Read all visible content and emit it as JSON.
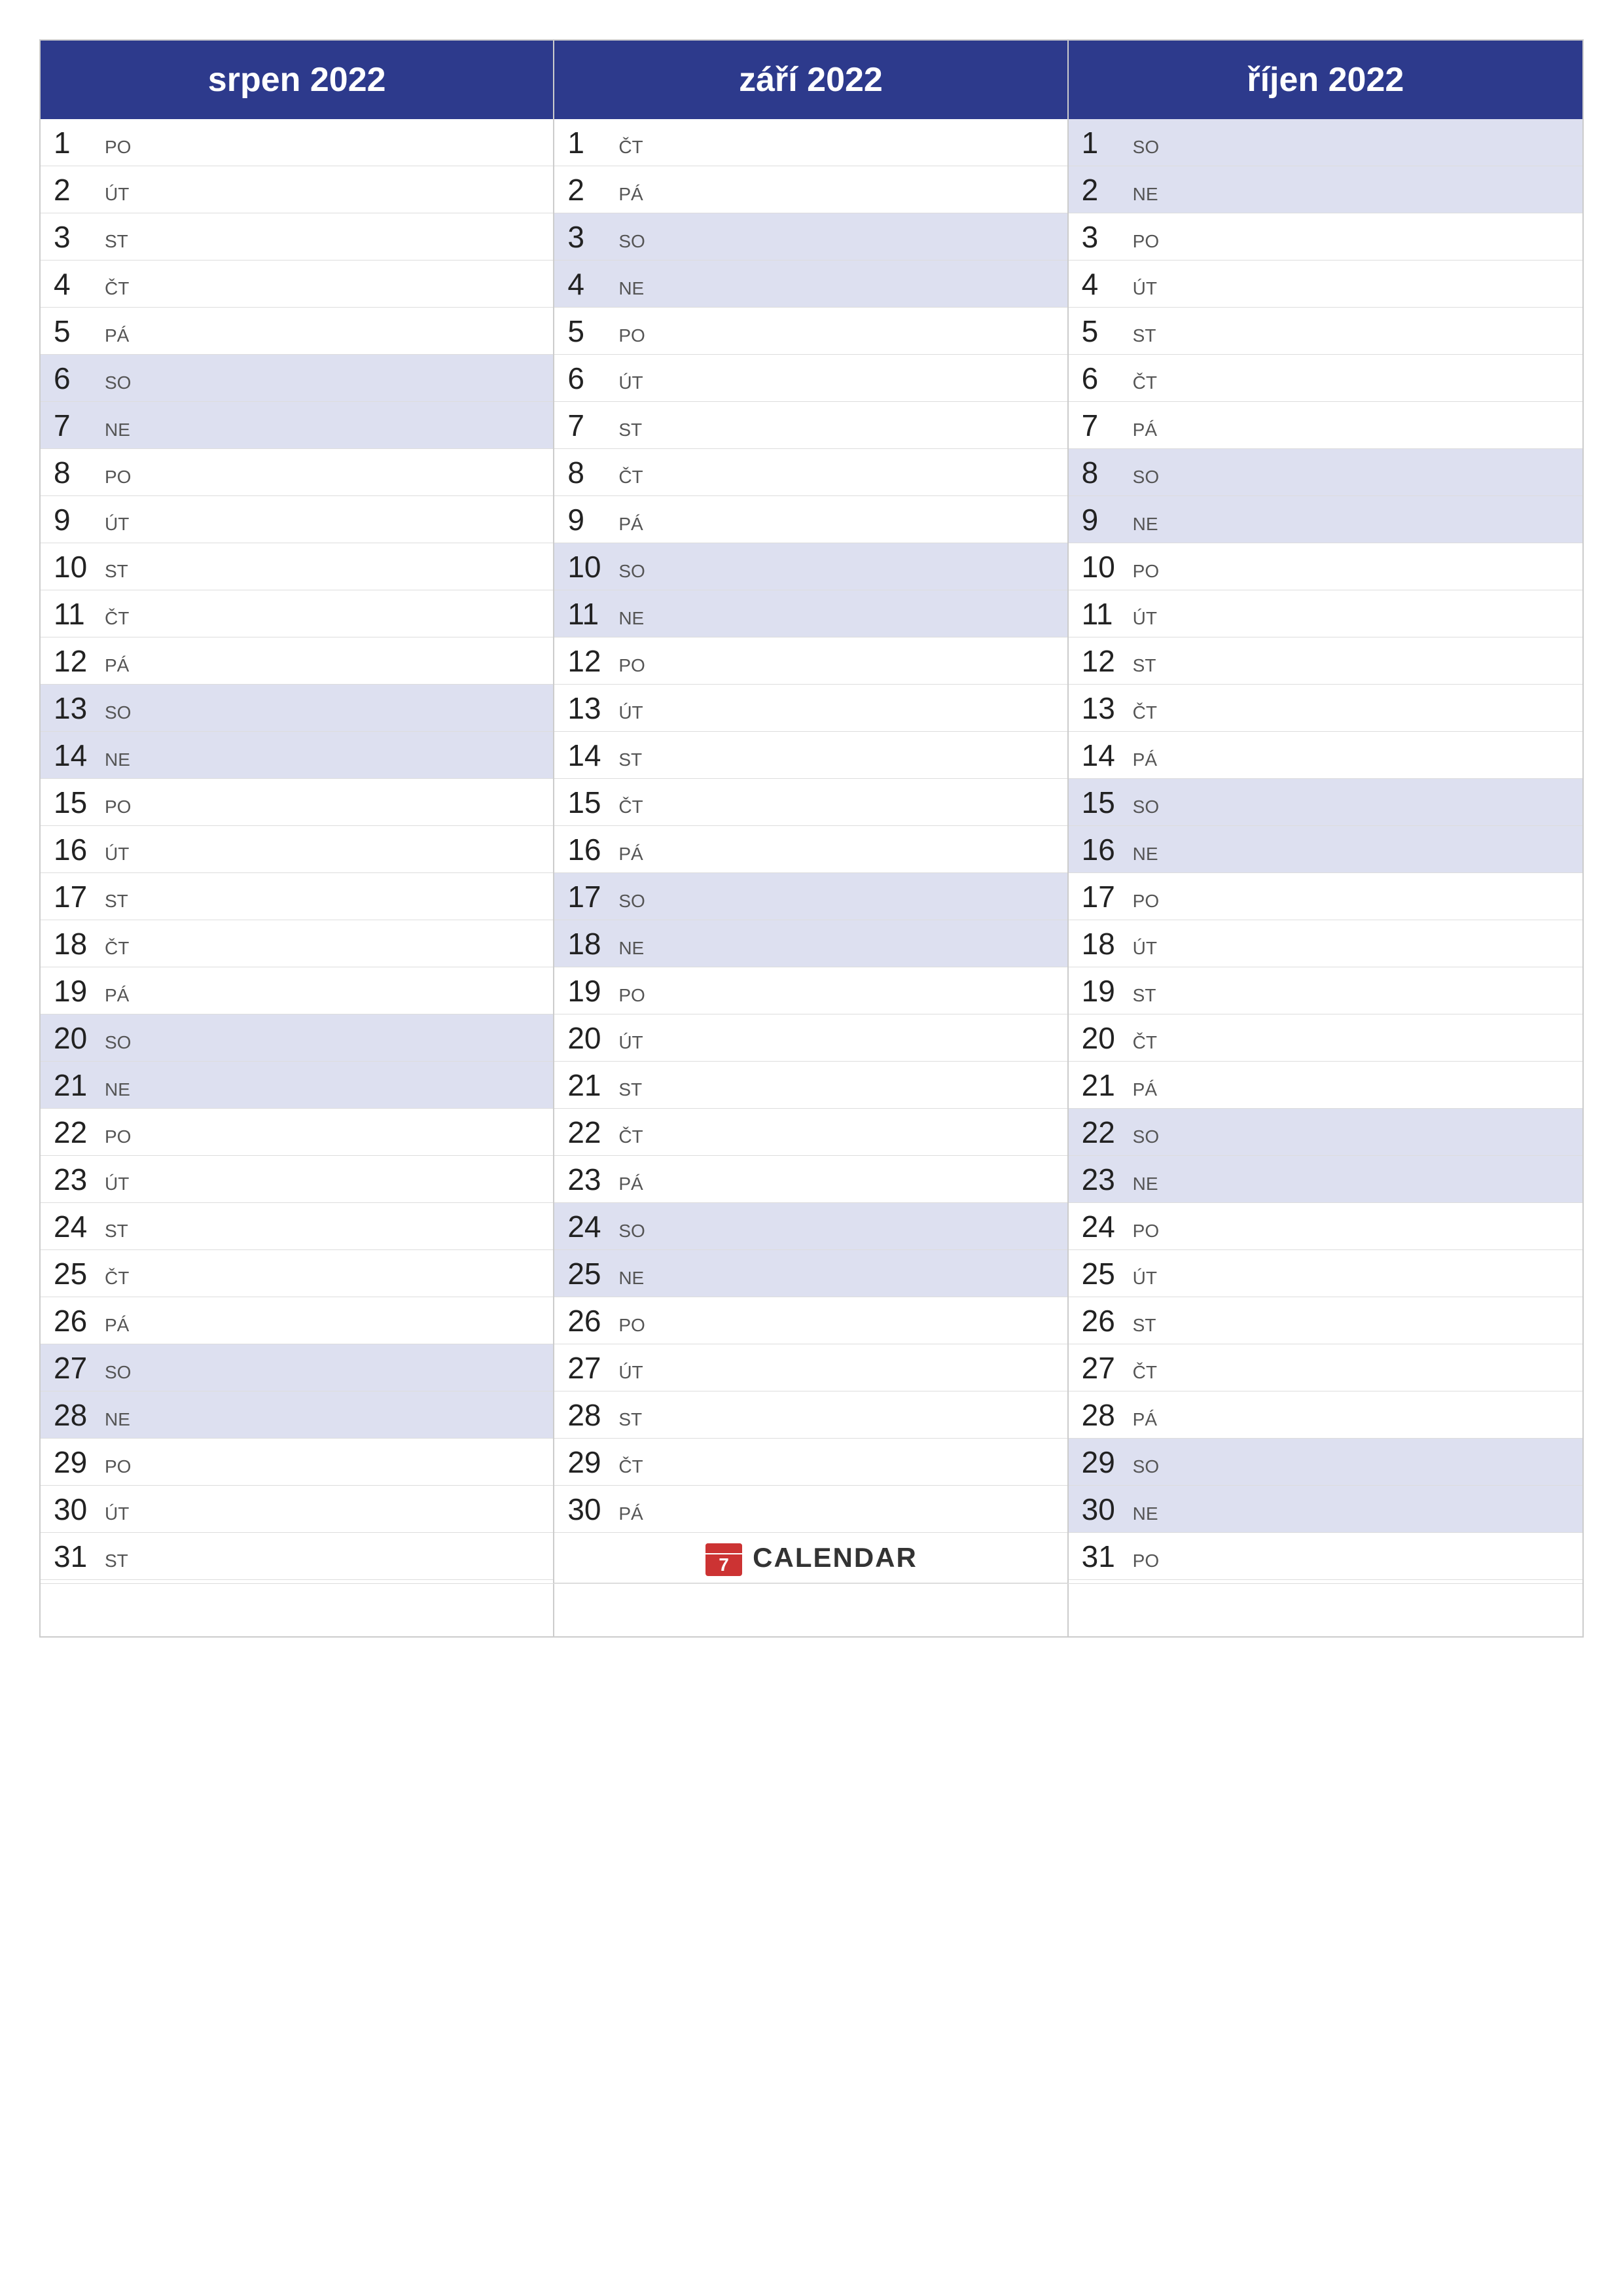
{
  "months": [
    {
      "name": "srpen 2022",
      "days": [
        {
          "num": "1",
          "day": "PO",
          "weekend": false
        },
        {
          "num": "2",
          "day": "ÚT",
          "weekend": false
        },
        {
          "num": "3",
          "day": "ST",
          "weekend": false
        },
        {
          "num": "4",
          "day": "ČT",
          "weekend": false
        },
        {
          "num": "5",
          "day": "PÁ",
          "weekend": false
        },
        {
          "num": "6",
          "day": "SO",
          "weekend": true
        },
        {
          "num": "7",
          "day": "NE",
          "weekend": true
        },
        {
          "num": "8",
          "day": "PO",
          "weekend": false
        },
        {
          "num": "9",
          "day": "ÚT",
          "weekend": false
        },
        {
          "num": "10",
          "day": "ST",
          "weekend": false
        },
        {
          "num": "11",
          "day": "ČT",
          "weekend": false
        },
        {
          "num": "12",
          "day": "PÁ",
          "weekend": false
        },
        {
          "num": "13",
          "day": "SO",
          "weekend": true
        },
        {
          "num": "14",
          "day": "NE",
          "weekend": true
        },
        {
          "num": "15",
          "day": "PO",
          "weekend": false
        },
        {
          "num": "16",
          "day": "ÚT",
          "weekend": false
        },
        {
          "num": "17",
          "day": "ST",
          "weekend": false
        },
        {
          "num": "18",
          "day": "ČT",
          "weekend": false
        },
        {
          "num": "19",
          "day": "PÁ",
          "weekend": false
        },
        {
          "num": "20",
          "day": "SO",
          "weekend": true
        },
        {
          "num": "21",
          "day": "NE",
          "weekend": true
        },
        {
          "num": "22",
          "day": "PO",
          "weekend": false
        },
        {
          "num": "23",
          "day": "ÚT",
          "weekend": false
        },
        {
          "num": "24",
          "day": "ST",
          "weekend": false
        },
        {
          "num": "25",
          "day": "ČT",
          "weekend": false
        },
        {
          "num": "26",
          "day": "PÁ",
          "weekend": false
        },
        {
          "num": "27",
          "day": "SO",
          "weekend": true
        },
        {
          "num": "28",
          "day": "NE",
          "weekend": true
        },
        {
          "num": "29",
          "day": "PO",
          "weekend": false
        },
        {
          "num": "30",
          "day": "ÚT",
          "weekend": false
        },
        {
          "num": "31",
          "day": "ST",
          "weekend": false
        }
      ]
    },
    {
      "name": "září 2022",
      "days": [
        {
          "num": "1",
          "day": "ČT",
          "weekend": false
        },
        {
          "num": "2",
          "day": "PÁ",
          "weekend": false
        },
        {
          "num": "3",
          "day": "SO",
          "weekend": true
        },
        {
          "num": "4",
          "day": "NE",
          "weekend": true
        },
        {
          "num": "5",
          "day": "PO",
          "weekend": false
        },
        {
          "num": "6",
          "day": "ÚT",
          "weekend": false
        },
        {
          "num": "7",
          "day": "ST",
          "weekend": false
        },
        {
          "num": "8",
          "day": "ČT",
          "weekend": false
        },
        {
          "num": "9",
          "day": "PÁ",
          "weekend": false
        },
        {
          "num": "10",
          "day": "SO",
          "weekend": true
        },
        {
          "num": "11",
          "day": "NE",
          "weekend": true
        },
        {
          "num": "12",
          "day": "PO",
          "weekend": false
        },
        {
          "num": "13",
          "day": "ÚT",
          "weekend": false
        },
        {
          "num": "14",
          "day": "ST",
          "weekend": false
        },
        {
          "num": "15",
          "day": "ČT",
          "weekend": false
        },
        {
          "num": "16",
          "day": "PÁ",
          "weekend": false
        },
        {
          "num": "17",
          "day": "SO",
          "weekend": true
        },
        {
          "num": "18",
          "day": "NE",
          "weekend": true
        },
        {
          "num": "19",
          "day": "PO",
          "weekend": false
        },
        {
          "num": "20",
          "day": "ÚT",
          "weekend": false
        },
        {
          "num": "21",
          "day": "ST",
          "weekend": false
        },
        {
          "num": "22",
          "day": "ČT",
          "weekend": false
        },
        {
          "num": "23",
          "day": "PÁ",
          "weekend": false
        },
        {
          "num": "24",
          "day": "SO",
          "weekend": true
        },
        {
          "num": "25",
          "day": "NE",
          "weekend": true
        },
        {
          "num": "26",
          "day": "PO",
          "weekend": false
        },
        {
          "num": "27",
          "day": "ÚT",
          "weekend": false
        },
        {
          "num": "28",
          "day": "ST",
          "weekend": false
        },
        {
          "num": "29",
          "day": "ČT",
          "weekend": false
        },
        {
          "num": "30",
          "day": "PÁ",
          "weekend": false
        }
      ]
    },
    {
      "name": "říjen 2022",
      "days": [
        {
          "num": "1",
          "day": "SO",
          "weekend": true
        },
        {
          "num": "2",
          "day": "NE",
          "weekend": true
        },
        {
          "num": "3",
          "day": "PO",
          "weekend": false
        },
        {
          "num": "4",
          "day": "ÚT",
          "weekend": false
        },
        {
          "num": "5",
          "day": "ST",
          "weekend": false
        },
        {
          "num": "6",
          "day": "ČT",
          "weekend": false
        },
        {
          "num": "7",
          "day": "PÁ",
          "weekend": false
        },
        {
          "num": "8",
          "day": "SO",
          "weekend": true
        },
        {
          "num": "9",
          "day": "NE",
          "weekend": true
        },
        {
          "num": "10",
          "day": "PO",
          "weekend": false
        },
        {
          "num": "11",
          "day": "ÚT",
          "weekend": false
        },
        {
          "num": "12",
          "day": "ST",
          "weekend": false
        },
        {
          "num": "13",
          "day": "ČT",
          "weekend": false
        },
        {
          "num": "14",
          "day": "PÁ",
          "weekend": false
        },
        {
          "num": "15",
          "day": "SO",
          "weekend": true
        },
        {
          "num": "16",
          "day": "NE",
          "weekend": true
        },
        {
          "num": "17",
          "day": "PO",
          "weekend": false
        },
        {
          "num": "18",
          "day": "ÚT",
          "weekend": false
        },
        {
          "num": "19",
          "day": "ST",
          "weekend": false
        },
        {
          "num": "20",
          "day": "ČT",
          "weekend": false
        },
        {
          "num": "21",
          "day": "PÁ",
          "weekend": false
        },
        {
          "num": "22",
          "day": "SO",
          "weekend": true
        },
        {
          "num": "23",
          "day": "NE",
          "weekend": true
        },
        {
          "num": "24",
          "day": "PO",
          "weekend": false
        },
        {
          "num": "25",
          "day": "ÚT",
          "weekend": false
        },
        {
          "num": "26",
          "day": "ST",
          "weekend": false
        },
        {
          "num": "27",
          "day": "ČT",
          "weekend": false
        },
        {
          "num": "28",
          "day": "PÁ",
          "weekend": false
        },
        {
          "num": "29",
          "day": "SO",
          "weekend": true
        },
        {
          "num": "30",
          "day": "NE",
          "weekend": true
        },
        {
          "num": "31",
          "day": "PO",
          "weekend": false
        }
      ]
    }
  ],
  "logo": {
    "text": "CALENDAR",
    "icon_color": "#cc3333"
  }
}
